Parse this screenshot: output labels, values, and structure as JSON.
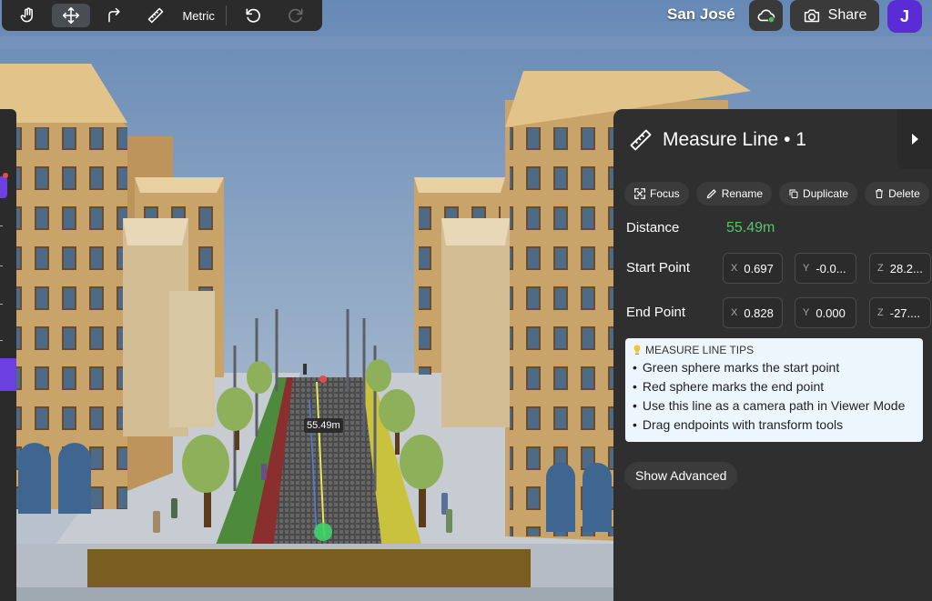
{
  "toolbar": {
    "tools": [
      {
        "icon": "hand-icon"
      },
      {
        "icon": "move-arrows-icon",
        "active": true
      },
      {
        "icon": "rotate-arrow-icon"
      },
      {
        "icon": "ruler-icon"
      }
    ],
    "units_label": "Metric",
    "undo_icon": "undo-icon",
    "redo_icon": "redo-icon"
  },
  "header": {
    "city": "San José",
    "share_label": "Share",
    "avatar_initial": "J",
    "cloud_icon": "cloud-sync-icon"
  },
  "scene": {
    "measure_label": "55.49m"
  },
  "panel": {
    "title": "Measure Line • 1",
    "actions": {
      "focus": "Focus",
      "rename": "Rename",
      "duplicate": "Duplicate",
      "delete": "Delete"
    },
    "distance": {
      "label": "Distance",
      "value": "55.49m"
    },
    "start_point": {
      "label": "Start Point",
      "x": "0.697",
      "y": "-0.0...",
      "z": "28.2..."
    },
    "end_point": {
      "label": "End Point",
      "x": "0.828",
      "y": "0.000",
      "z": "-27...."
    },
    "axes": {
      "x": "X",
      "y": "Y",
      "z": "Z"
    },
    "tips": {
      "title": "MEASURE LINE TIPS",
      "items": [
        "Green sphere marks the start point",
        "Red sphere marks the end point",
        "Use this line as a camera path in Viewer Mode",
        "Drag endpoints with transform tools"
      ]
    },
    "advanced_label": "Show Advanced"
  },
  "colors": {
    "accent": "#5b2bd6",
    "distance": "#58c46a",
    "panel_bg": "#2f2f2f",
    "tips_bg": "#eef6fd"
  }
}
